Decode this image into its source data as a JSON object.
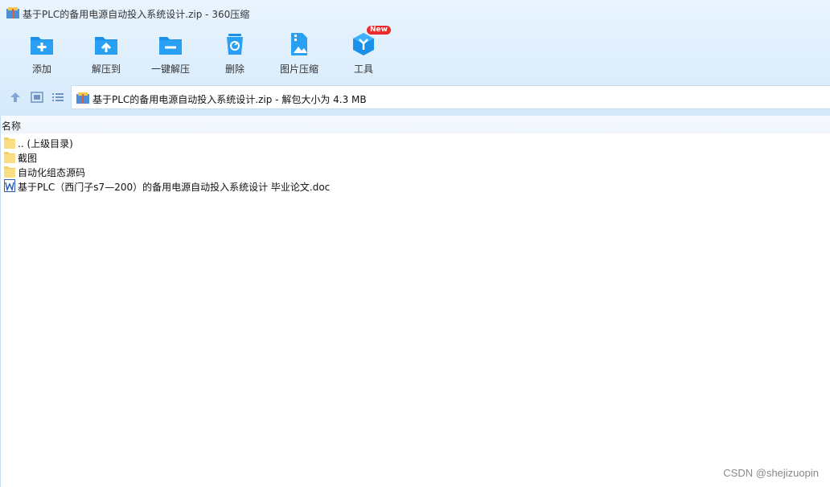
{
  "window": {
    "title": "基于PLC的备用电源自动投入系统设计.zip - 360压缩"
  },
  "toolbar": {
    "items": [
      {
        "label": "添加",
        "icon": "add-folder-icon"
      },
      {
        "label": "解压到",
        "icon": "extract-to-icon"
      },
      {
        "label": "一键解压",
        "icon": "one-click-extract-icon"
      },
      {
        "label": "删除",
        "icon": "recycle-bin-icon"
      },
      {
        "label": "图片压缩",
        "icon": "image-compress-icon"
      },
      {
        "label": "工具",
        "icon": "tools-icon",
        "badge": "New"
      }
    ]
  },
  "nav": {
    "path_text": "基于PLC的备用电源自动投入系统设计.zip - 解包大小为 4.3 MB"
  },
  "list": {
    "column_name": "名称",
    "rows": [
      {
        "name": ".. (上级目录)",
        "type": "folder"
      },
      {
        "name": "截图",
        "type": "folder"
      },
      {
        "name": "自动化组态源码",
        "type": "folder"
      },
      {
        "name": "基于PLC（西门子s7—200）的备用电源自动投入系统设计 毕业论文.doc",
        "type": "word-doc"
      }
    ]
  },
  "watermark": "CSDN @shejizuopin",
  "colors": {
    "accent": "#1a8fe8",
    "badge": "#ee2b2b",
    "folder": "#f6cf5f"
  }
}
